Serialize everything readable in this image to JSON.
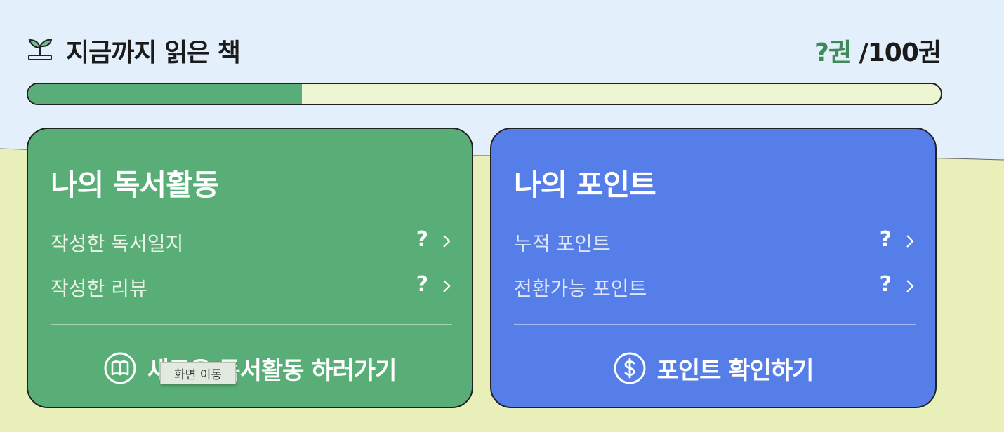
{
  "header": {
    "title": "지금까지 읽은 책",
    "read_count": "?권",
    "separator": "/",
    "goal_count": "100권",
    "progress": 0.3
  },
  "reading_card": {
    "title": "나의 독서활동",
    "rows": [
      {
        "label": "작성한 독서일지",
        "value": "?"
      },
      {
        "label": "작성한 리뷰",
        "value": "?"
      }
    ],
    "action_label": "새로운 독서활동 하러가기",
    "action_icon": "book-icon"
  },
  "points_card": {
    "title": "나의 포인트",
    "rows": [
      {
        "label": "누적 포인트",
        "value": "?"
      },
      {
        "label": "전환가능 포인트",
        "value": "?"
      }
    ],
    "action_label": "포인트 확인하기",
    "action_icon": "dollar-icon"
  },
  "tooltip": {
    "text": "화면 이동"
  },
  "colors": {
    "sky": "#e3f0fb",
    "ground": "#e9efb9",
    "green_card": "#59ae77",
    "blue_card": "#557ee8",
    "progress_fill": "#58ad79",
    "accent_text": "#3f8a5a"
  }
}
